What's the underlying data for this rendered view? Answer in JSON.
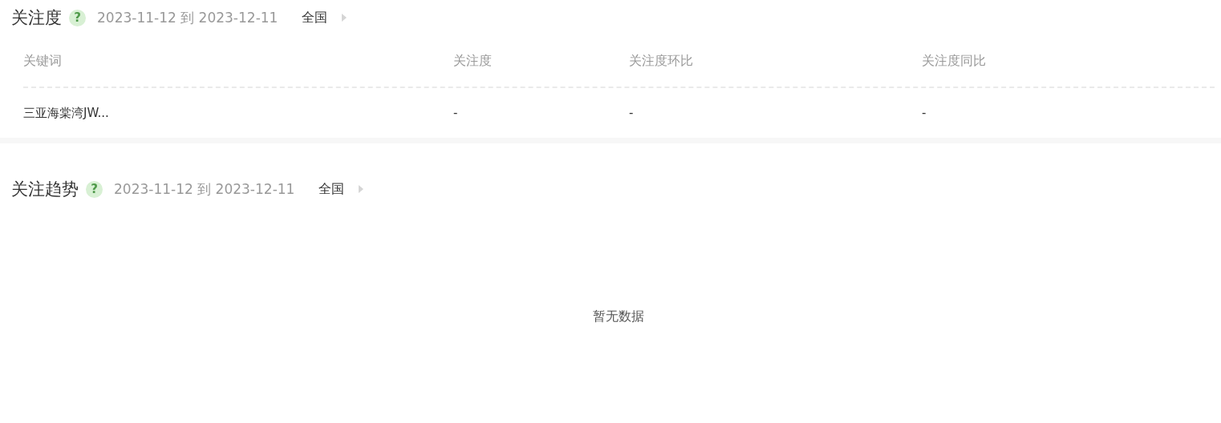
{
  "attention": {
    "title": "关注度",
    "help": "?",
    "date_range": "2023-11-12 到 2023-12-11",
    "region": "全国",
    "table": {
      "columns": [
        "关键词",
        "关注度",
        "关注度环比",
        "关注度同比"
      ],
      "rows": [
        [
          "三亚海棠湾JW...",
          "-",
          "-",
          "-"
        ]
      ]
    }
  },
  "trend": {
    "title": "关注趋势",
    "help": "?",
    "date_range": "2023-11-12 到 2023-12-11",
    "region": "全国",
    "empty_message": "暂无数据"
  }
}
